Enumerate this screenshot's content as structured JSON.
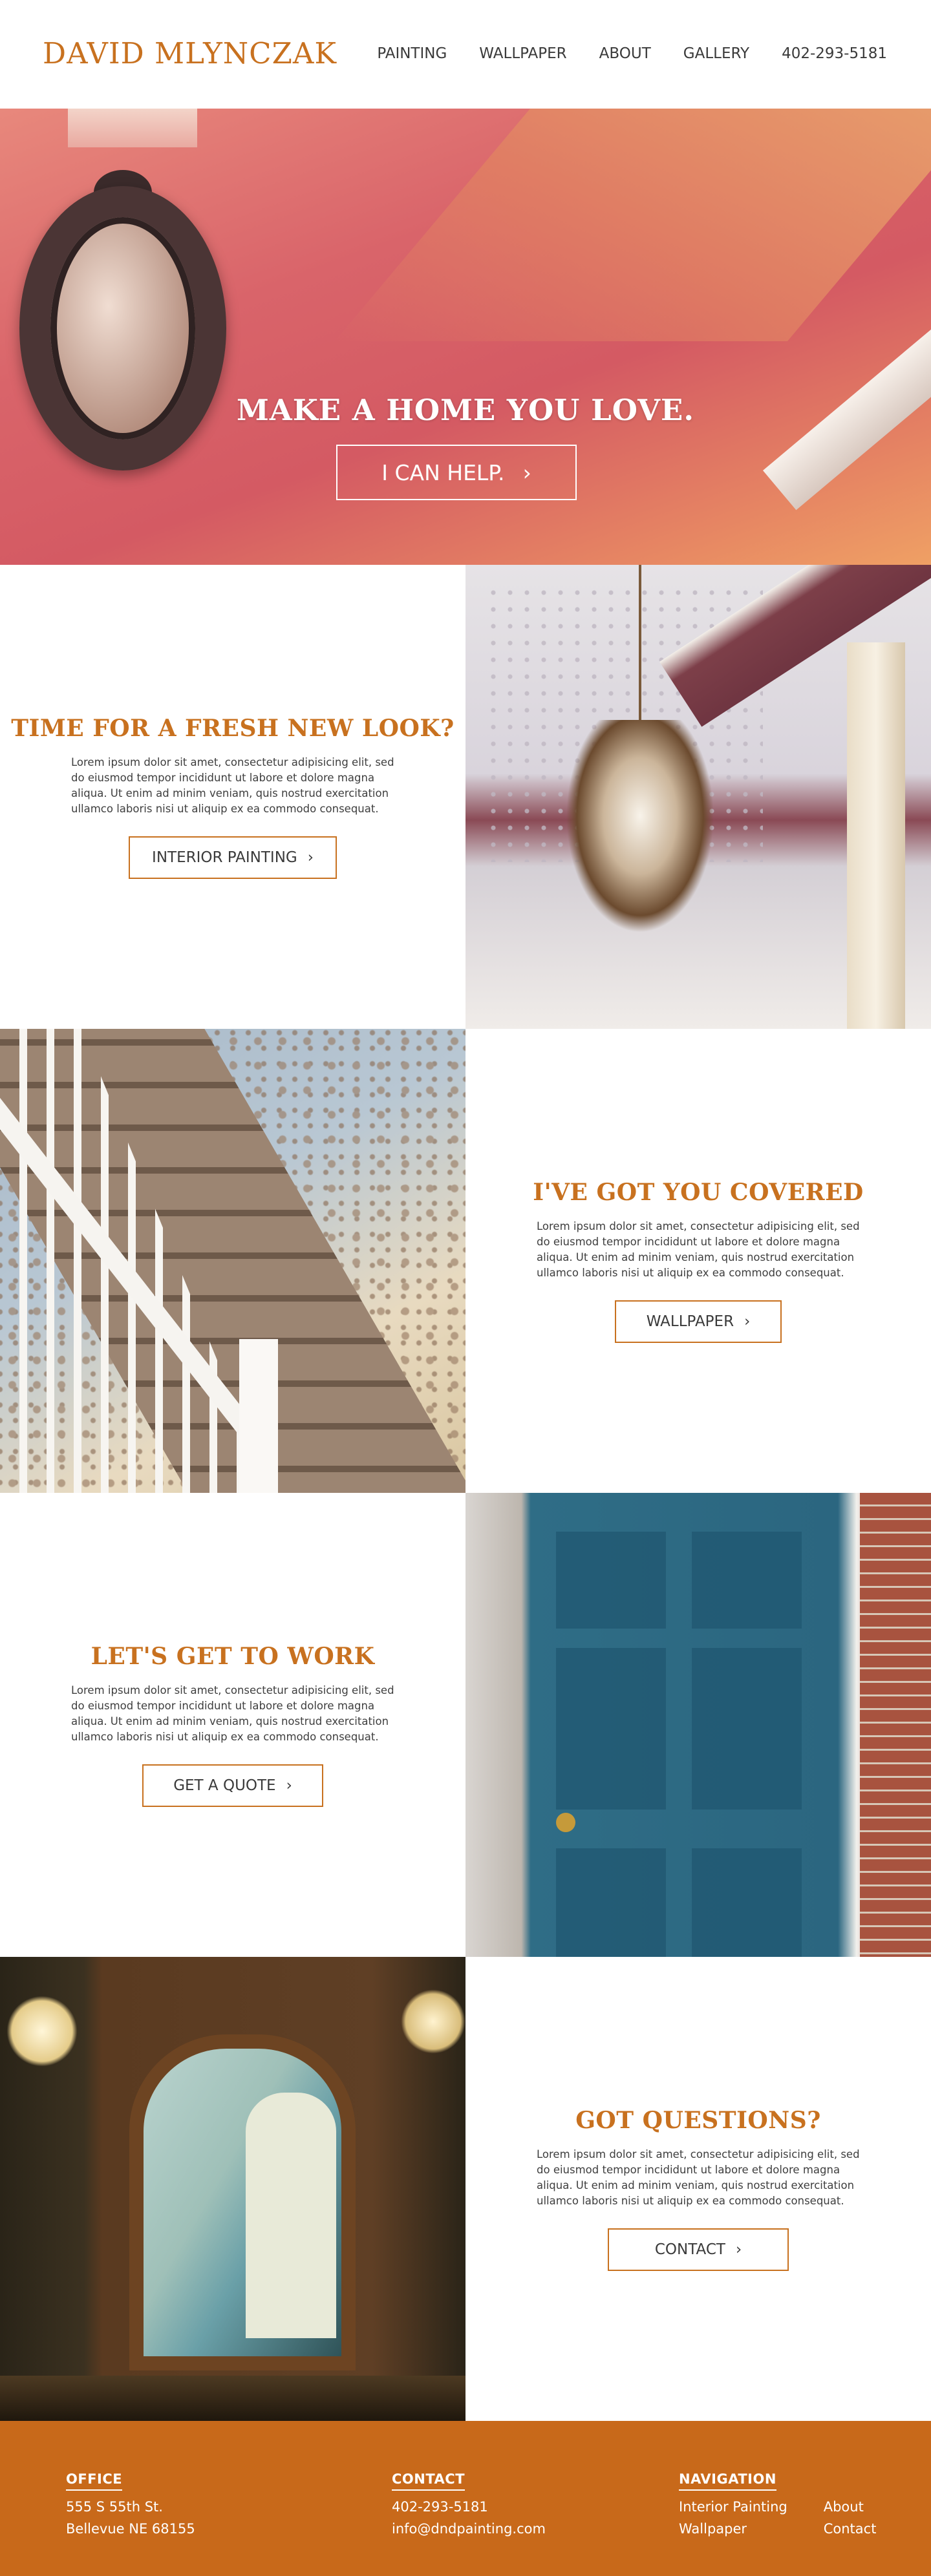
{
  "header": {
    "logo": "DAVID MLYNCZAK",
    "nav": [
      "PAINTING",
      "WALLPAPER",
      "ABOUT",
      "GALLERY",
      "402-293-5181"
    ]
  },
  "hero": {
    "title": "MAKE A HOME YOU LOVE.",
    "button": "I CAN HELP.",
    "chevron": "›"
  },
  "sections": [
    {
      "title": "TIME FOR A FRESH NEW LOOK?",
      "body": "Lorem ipsum dolor sit amet, consectetur adipisicing elit, sed do eiusmod tempor incididunt ut labore et dolore magna aliqua. Ut enim ad minim veniam, quis nostrud exercitation ullamco laboris nisi ut aliquip ex ea commodo consequat.",
      "button": "INTERIOR PAINTING"
    },
    {
      "title": "I'VE GOT YOU COVERED",
      "body": "Lorem ipsum dolor sit amet, consectetur adipisicing elit, sed do eiusmod tempor incididunt ut labore et dolore magna aliqua. Ut enim ad minim veniam, quis nostrud exercitation ullamco laboris nisi ut aliquip ex ea commodo consequat.",
      "button": "WALLPAPER"
    },
    {
      "title": "LET'S GET TO WORK",
      "body": "Lorem ipsum dolor sit amet, consectetur adipisicing elit, sed do eiusmod tempor incididunt ut labore et dolore magna aliqua. Ut enim ad minim veniam, quis nostrud exercitation ullamco laboris nisi ut aliquip ex ea commodo consequat.",
      "button": "GET A QUOTE"
    },
    {
      "title": "GOT QUESTIONS?",
      "body": "Lorem ipsum dolor sit amet, consectetur adipisicing elit, sed do eiusmod tempor incididunt ut labore et dolore magna aliqua. Ut enim ad minim veniam, quis nostrud exercitation ullamco laboris nisi ut aliquip ex ea commodo consequat.",
      "button": "CONTACT"
    }
  ],
  "footer": {
    "office": {
      "heading": "OFFICE",
      "line1": "555 S 55th St.",
      "line2": "Bellevue NE 68155"
    },
    "contact": {
      "heading": "CONTACT",
      "line1": "402-293-5181",
      "line2": "info@dndpainting.com"
    },
    "navigation": {
      "heading": "NAVIGATION",
      "links": [
        "Interior Painting",
        "About",
        "Wallpaper",
        "Contact"
      ]
    }
  },
  "colors": {
    "accent": "#c8711f",
    "footer_bg": "#c8691a",
    "text": "#3e3e3e"
  },
  "icons": {
    "chevron": "chevron-right-icon"
  }
}
